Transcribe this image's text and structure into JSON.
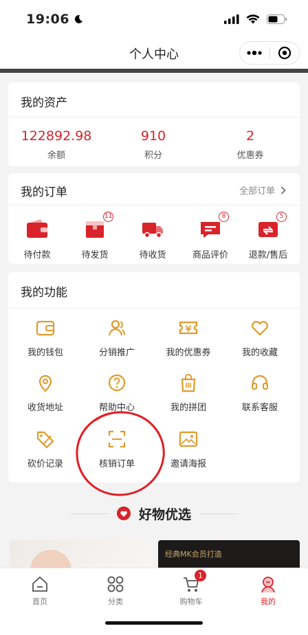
{
  "status_bar": {
    "time": "19:06"
  },
  "nav": {
    "title": "个人中心"
  },
  "assets": {
    "title": "我的资产",
    "items": [
      {
        "value": "122892.98",
        "label": "余额"
      },
      {
        "value": "910",
        "label": "积分"
      },
      {
        "value": "2",
        "label": "优惠券"
      }
    ]
  },
  "orders": {
    "title": "我的订单",
    "all_link": "全部订单",
    "items": [
      {
        "label": "待付款",
        "badge": ""
      },
      {
        "label": "待发货",
        "badge": "11"
      },
      {
        "label": "待收货",
        "badge": ""
      },
      {
        "label": "商品评价",
        "badge": "8"
      },
      {
        "label": "退款/售后",
        "badge": "5"
      }
    ]
  },
  "functions": {
    "title": "我的功能",
    "items": [
      {
        "label": "我的钱包",
        "icon": "wallet-icon"
      },
      {
        "label": "分销推广",
        "icon": "people-icon"
      },
      {
        "label": "我的优惠券",
        "icon": "coupon-icon"
      },
      {
        "label": "我的收藏",
        "icon": "heart-icon"
      },
      {
        "label": "收货地址",
        "icon": "location-icon"
      },
      {
        "label": "帮助中心",
        "icon": "help-icon"
      },
      {
        "label": "我的拼团",
        "icon": "group-bag-icon"
      },
      {
        "label": "联系客服",
        "icon": "headset-icon"
      },
      {
        "label": "砍价记录",
        "icon": "tag-icon"
      },
      {
        "label": "核销订单",
        "icon": "scan-icon"
      },
      {
        "label": "邀请海报",
        "icon": "poster-icon"
      }
    ]
  },
  "recommend": {
    "title": "好物优选",
    "banner_right_text": "经典MK会员打造"
  },
  "tab_bar": {
    "tabs": [
      {
        "label": "首页"
      },
      {
        "label": "分类"
      },
      {
        "label": "购物车",
        "badge": "1"
      },
      {
        "label": "我的"
      }
    ]
  },
  "colors": {
    "accent": "#d8232a",
    "icon_gold": "#e09a2a"
  }
}
